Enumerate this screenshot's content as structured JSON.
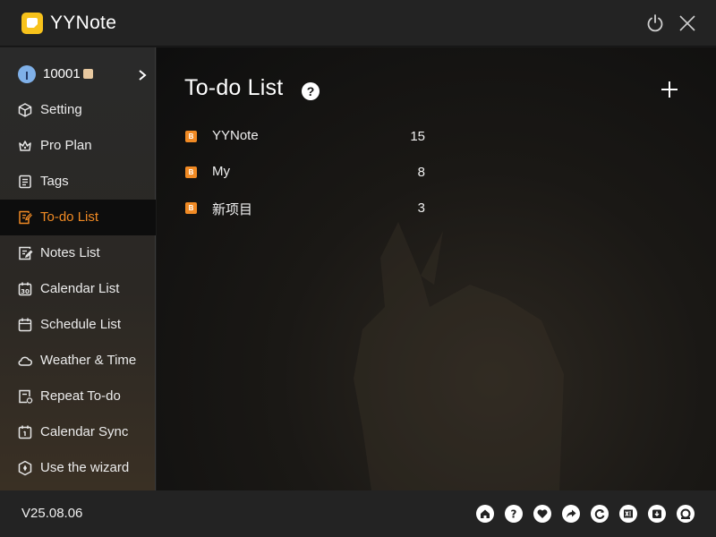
{
  "app": {
    "title": "YYNote",
    "brand_color": "#f7c21b",
    "accent_color": "#f08a24"
  },
  "titlebar": {
    "icons": [
      "app-logo-icon",
      "power-icon",
      "close-icon"
    ]
  },
  "sidebar": {
    "user": {
      "id": "10001",
      "icons": [
        "avatar-icon",
        "membership-badge-icon",
        "chevron-right-icon"
      ]
    },
    "items": [
      {
        "label": "Setting",
        "icon": "cube-icon",
        "active": false
      },
      {
        "label": "Pro Plan",
        "icon": "crown-icon",
        "active": false
      },
      {
        "label": "Tags",
        "icon": "tag-list-icon",
        "active": false
      },
      {
        "label": "To-do List",
        "icon": "todo-list-icon",
        "active": true
      },
      {
        "label": "Notes List",
        "icon": "notes-list-icon",
        "active": false
      },
      {
        "label": "Calendar List",
        "icon": "calendar-30-icon",
        "active": false
      },
      {
        "label": "Schedule List",
        "icon": "schedule-calendar-icon",
        "active": false
      },
      {
        "label": "Weather & Time",
        "icon": "cloud-icon",
        "active": false
      },
      {
        "label": "Repeat To-do",
        "icon": "repeat-doc-icon",
        "active": false
      },
      {
        "label": "Calendar Sync",
        "icon": "calendar-sync-icon",
        "active": false
      },
      {
        "label": "Use the wizard",
        "icon": "wizard-icon",
        "active": false
      }
    ]
  },
  "main": {
    "title": "To-do List",
    "help_label": "?",
    "add_icon": "plus-icon",
    "rows": [
      {
        "badge": "B",
        "name": "YYNote",
        "count": "15"
      },
      {
        "badge": "B",
        "name": "My",
        "count": "8"
      },
      {
        "badge": "B",
        "name": "新项目",
        "count": "3"
      }
    ]
  },
  "footer": {
    "version": "V25.08.06",
    "icons": [
      "home-icon",
      "help-icon",
      "heart-icon",
      "share-icon",
      "refresh-icon",
      "excel-export-icon",
      "download-icon",
      "support-icon"
    ]
  }
}
